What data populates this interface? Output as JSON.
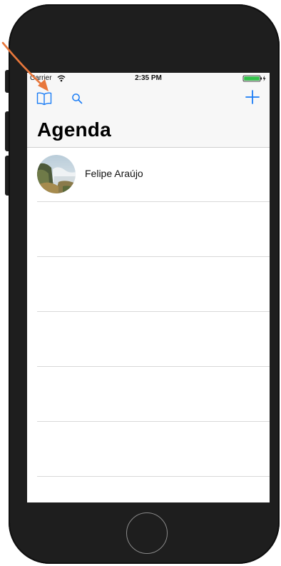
{
  "status_bar": {
    "carrier": "Carrier",
    "time": "2:35 PM"
  },
  "nav_bar": {
    "title": "Agenda",
    "left_icons": [
      "bookmarks-icon",
      "search-icon"
    ],
    "right_icon": "plus-icon"
  },
  "contacts": [
    {
      "name": "Felipe Araújo",
      "avatar": "waterfall-photo"
    },
    {
      "name": ""
    },
    {
      "name": ""
    },
    {
      "name": ""
    },
    {
      "name": ""
    },
    {
      "name": ""
    }
  ],
  "colors": {
    "tint": "#1a7cf5",
    "annotation_arrow": "#e8773b",
    "phone_body": "#1e1e1e",
    "bar_background": "#f7f7f7",
    "battery": "#33c24a"
  }
}
